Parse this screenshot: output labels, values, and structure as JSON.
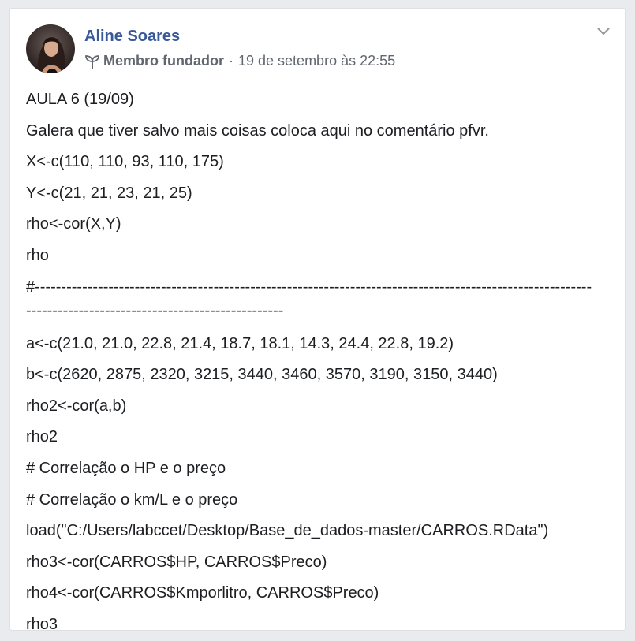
{
  "post": {
    "author": "Aline Soares",
    "badge": "Membro fundador",
    "separator": "·",
    "timestamp": "19 de setembro às 22:55",
    "lines": [
      "AULA 6 (19/09)",
      "Galera que tiver salvo mais coisas coloca aqui no comentário pfvr.",
      "X<-c(110, 110, 93, 110, 175)",
      "Y<-c(21, 21, 23, 21, 25)",
      "rho<-cor(X,Y)",
      "rho"
    ],
    "dash_line_1": "#----------------------------------------------------------------------------------------------------------",
    "dash_line_2": "-------------------------------------------------",
    "lines2": [
      "a<-c(21.0, 21.0, 22.8, 21.4, 18.7, 18.1, 14.3, 24.4, 22.8, 19.2)",
      "b<-c(2620, 2875, 2320, 3215, 3440, 3460, 3570, 3190, 3150, 3440)",
      "rho2<-cor(a,b)",
      "rho2",
      "# Correlação o HP e o preço",
      "# Correlação o km/L e o preço",
      "load(\"C:/Users/labccet/Desktop/Base_de_dados-master/CARROS.RData\")",
      "rho3<-cor(CARROS$HP, CARROS$Preco)",
      "rho4<-cor(CARROS$Kmporlitro, CARROS$Preco)",
      "rho3"
    ]
  },
  "colors": {
    "author_link": "#385898",
    "meta_text": "#616770",
    "body_text": "#1c1e21",
    "background": "#e9ebee"
  },
  "icons": {
    "badge": "sprout-icon",
    "menu": "chevron-down-icon"
  }
}
